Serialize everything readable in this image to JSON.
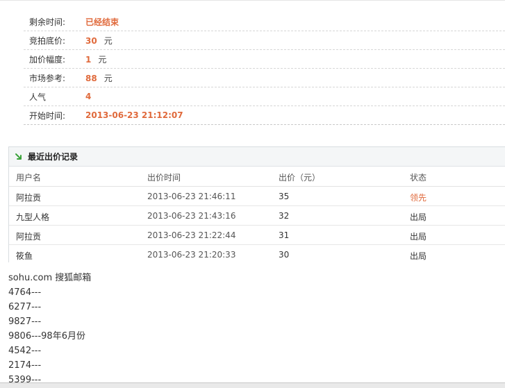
{
  "info": {
    "rows": [
      {
        "label": "剩余时间:",
        "value": "已经结束",
        "unit": ""
      },
      {
        "label": "竞拍底价:",
        "value": "30",
        "unit": "元"
      },
      {
        "label": "加价幅度:",
        "value": "1",
        "unit": "元"
      },
      {
        "label": "市场参考:",
        "value": "88",
        "unit": "元"
      },
      {
        "label": "人气",
        "value": "4",
        "unit": ""
      },
      {
        "label": "开始时间:",
        "value": "2013-06-23 21:12:07",
        "unit": ""
      }
    ]
  },
  "bid_record": {
    "title": "最近出价记录",
    "columns": [
      "用户名",
      "出价时间",
      "出价（元）",
      "状态"
    ],
    "rows": [
      {
        "user": "阿拉贡",
        "time": "2013-06-23 21:46:11",
        "price": "35",
        "status": "领先"
      },
      {
        "user": "九型人格",
        "time": "2013-06-23 21:43:16",
        "price": "32",
        "status": "出局"
      },
      {
        "user": "阿拉贡",
        "time": "2013-06-23 21:22:44",
        "price": "31",
        "status": "出局"
      },
      {
        "user": "筱鱼",
        "time": "2013-06-23 21:20:33",
        "price": "30",
        "status": "出局"
      }
    ]
  },
  "notes": [
    "sohu.com 搜狐邮箱",
    "4764---",
    "6277---",
    "9827---",
    "9806---98年6月份",
    "4542---",
    "2174---",
    "5399---"
  ],
  "colors": {
    "accent": "#e06a3c",
    "arrow": "#3aa23a"
  }
}
